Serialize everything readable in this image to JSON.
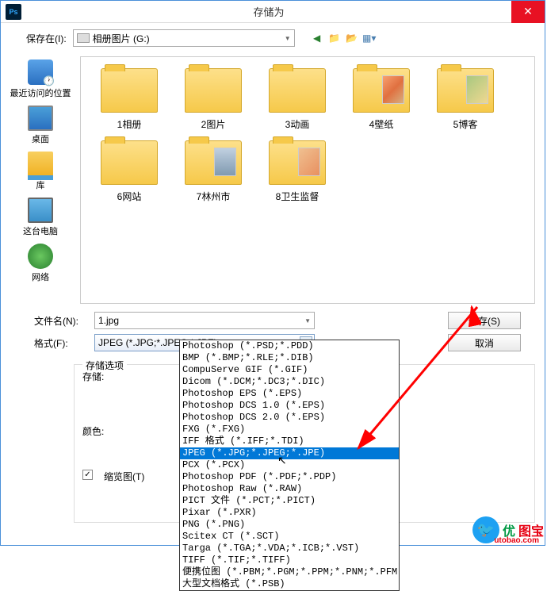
{
  "window": {
    "title": "存储为",
    "app_icon": "Ps"
  },
  "toolbar": {
    "save_in_label": "保存在(I):",
    "location": "相册图片 (G:)",
    "nav_icons": [
      "back-icon",
      "up-icon",
      "new-folder-icon",
      "view-icon"
    ]
  },
  "sidebar": [
    {
      "label": "最近访问的位置",
      "icon": "recent"
    },
    {
      "label": "桌面",
      "icon": "desktop"
    },
    {
      "label": "库",
      "icon": "lib"
    },
    {
      "label": "这台电脑",
      "icon": "pc"
    },
    {
      "label": "网络",
      "icon": "net"
    }
  ],
  "folders": [
    {
      "label": "1相册"
    },
    {
      "label": "2图片"
    },
    {
      "label": "3动画"
    },
    {
      "label": "4壁纸",
      "thumb": "thumb-img1"
    },
    {
      "label": "5博客",
      "thumb": "thumb-img2"
    },
    {
      "label": "6网站"
    },
    {
      "label": "7林州市",
      "thumb": "thumb-img3"
    },
    {
      "label": "8卫生监督",
      "thumb": "thumb-img4"
    }
  ],
  "form": {
    "filename_label": "文件名(N):",
    "filename_value": "1.jpg",
    "format_label": "格式(F):",
    "format_value": "JPEG (*.JPG;*.JPEG;*.JPE)",
    "save_btn": "保存(S)",
    "cancel_btn": "取消"
  },
  "dropdown": {
    "items": [
      "Photoshop (*.PSD;*.PDD)",
      "BMP (*.BMP;*.RLE;*.DIB)",
      "CompuServe GIF (*.GIF)",
      "Dicom (*.DCM;*.DC3;*.DIC)",
      "Photoshop EPS (*.EPS)",
      "Photoshop DCS 1.0 (*.EPS)",
      "Photoshop DCS 2.0 (*.EPS)",
      "FXG (*.FXG)",
      "IFF 格式 (*.IFF;*.TDI)",
      "JPEG (*.JPG;*.JPEG;*.JPE)",
      "PCX (*.PCX)",
      "Photoshop PDF (*.PDF;*.PDP)",
      "Photoshop Raw (*.RAW)",
      "PICT 文件 (*.PCT;*.PICT)",
      "Pixar (*.PXR)",
      "PNG (*.PNG)",
      "Scitex CT (*.SCT)",
      "Targa (*.TGA;*.VDA;*.ICB;*.VST)",
      "TIFF (*.TIF;*.TIFF)",
      "便携位图 (*.PBM;*.PGM;*.PPM;*.PNM;*.PFM;*.PAM)",
      "大型文档格式 (*.PSB)"
    ],
    "selected_index": 9
  },
  "options": {
    "panel_title": "存储选项",
    "save_label": "存储:",
    "color_label": "颜色:",
    "thumbnail_label": "缩览图(T)",
    "thumbnail_checked": true
  },
  "watermark": {
    "brand1": "优",
    "brand2": "图宝",
    "url": "utobao.com"
  }
}
